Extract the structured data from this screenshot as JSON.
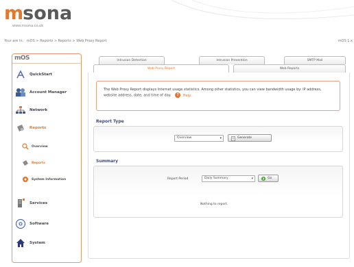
{
  "brand": {
    "logo_m": "m",
    "logo_rest": "sona",
    "url": "www.msona.co.uk"
  },
  "breadcrumb": {
    "prefix": "Your are in:",
    "path": "mOS > Reports > Reports > Web Proxy Report"
  },
  "header_right": "mOS 1.x",
  "sidebar": {
    "title": "mOS",
    "items": [
      {
        "label": "QuickStart",
        "icon": "quickstart-icon"
      },
      {
        "label": "Account Manager",
        "icon": "account-manager-icon"
      },
      {
        "label": "Network",
        "icon": "network-icon"
      },
      {
        "label": "Reports",
        "icon": "reports-icon"
      },
      {
        "label": "Services",
        "icon": "services-icon"
      },
      {
        "label": "Software",
        "icon": "software-icon"
      },
      {
        "label": "System",
        "icon": "system-icon"
      }
    ],
    "sub_items": [
      {
        "label": "Overview",
        "icon": "overview-icon"
      },
      {
        "label": "Reports",
        "icon": "reports-sub-icon"
      },
      {
        "label": "System Information",
        "icon": "system-information-icon"
      }
    ]
  },
  "tabs": {
    "row1": [
      "Intrusion Detection",
      "Intrusion Prevention",
      "SMTP Mail"
    ],
    "row2": [
      "Web Proxy Report",
      "Web Reports"
    ],
    "active": "Web Proxy Report"
  },
  "intro": {
    "text": "The Web Proxy Report displays Internet usage statistics. Among other statistics, you can view bandwidth usage by: IP address, website address, date, and time of day.",
    "help_label": "Help"
  },
  "report_type": {
    "title": "Report Type",
    "select_value": "Overview",
    "generate_label": "Generate"
  },
  "summary": {
    "title": "Summary",
    "period_label": "Report Period",
    "period_value": "Daily Summary",
    "go_label": "Go",
    "empty_message": "Nothing to report."
  },
  "colors": {
    "accent": "#e0792f",
    "border_accent": "#e09a6a",
    "section_title": "#3a4a7a"
  }
}
